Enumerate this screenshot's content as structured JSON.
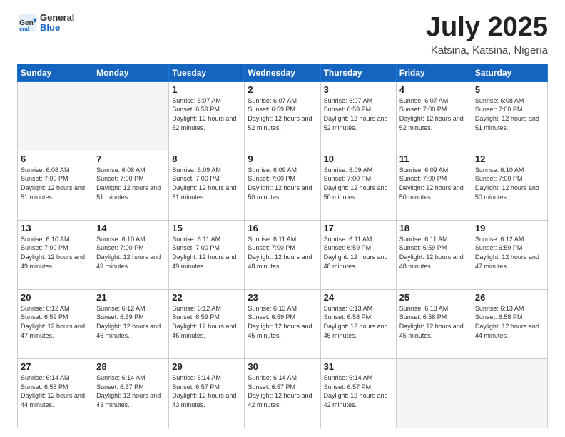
{
  "header": {
    "logo": {
      "general": "General",
      "blue": "Blue"
    },
    "title": "July 2025",
    "location": "Katsina, Katsina, Nigeria"
  },
  "weekdays": [
    "Sunday",
    "Monday",
    "Tuesday",
    "Wednesday",
    "Thursday",
    "Friday",
    "Saturday"
  ],
  "weeks": [
    [
      {
        "day": "",
        "info": ""
      },
      {
        "day": "",
        "info": ""
      },
      {
        "day": "1",
        "info": "Sunrise: 6:07 AM\nSunset: 6:59 PM\nDaylight: 12 hours and 52 minutes."
      },
      {
        "day": "2",
        "info": "Sunrise: 6:07 AM\nSunset: 6:59 PM\nDaylight: 12 hours and 52 minutes."
      },
      {
        "day": "3",
        "info": "Sunrise: 6:07 AM\nSunset: 6:59 PM\nDaylight: 12 hours and 52 minutes."
      },
      {
        "day": "4",
        "info": "Sunrise: 6:07 AM\nSunset: 7:00 PM\nDaylight: 12 hours and 52 minutes."
      },
      {
        "day": "5",
        "info": "Sunrise: 6:08 AM\nSunset: 7:00 PM\nDaylight: 12 hours and 51 minutes."
      }
    ],
    [
      {
        "day": "6",
        "info": "Sunrise: 6:08 AM\nSunset: 7:00 PM\nDaylight: 12 hours and 51 minutes."
      },
      {
        "day": "7",
        "info": "Sunrise: 6:08 AM\nSunset: 7:00 PM\nDaylight: 12 hours and 51 minutes."
      },
      {
        "day": "8",
        "info": "Sunrise: 6:09 AM\nSunset: 7:00 PM\nDaylight: 12 hours and 51 minutes."
      },
      {
        "day": "9",
        "info": "Sunrise: 6:09 AM\nSunset: 7:00 PM\nDaylight: 12 hours and 50 minutes."
      },
      {
        "day": "10",
        "info": "Sunrise: 6:09 AM\nSunset: 7:00 PM\nDaylight: 12 hours and 50 minutes."
      },
      {
        "day": "11",
        "info": "Sunrise: 6:09 AM\nSunset: 7:00 PM\nDaylight: 12 hours and 50 minutes."
      },
      {
        "day": "12",
        "info": "Sunrise: 6:10 AM\nSunset: 7:00 PM\nDaylight: 12 hours and 50 minutes."
      }
    ],
    [
      {
        "day": "13",
        "info": "Sunrise: 6:10 AM\nSunset: 7:00 PM\nDaylight: 12 hours and 49 minutes."
      },
      {
        "day": "14",
        "info": "Sunrise: 6:10 AM\nSunset: 7:00 PM\nDaylight: 12 hours and 49 minutes."
      },
      {
        "day": "15",
        "info": "Sunrise: 6:11 AM\nSunset: 7:00 PM\nDaylight: 12 hours and 49 minutes."
      },
      {
        "day": "16",
        "info": "Sunrise: 6:11 AM\nSunset: 7:00 PM\nDaylight: 12 hours and 48 minutes."
      },
      {
        "day": "17",
        "info": "Sunrise: 6:11 AM\nSunset: 6:59 PM\nDaylight: 12 hours and 48 minutes."
      },
      {
        "day": "18",
        "info": "Sunrise: 6:11 AM\nSunset: 6:59 PM\nDaylight: 12 hours and 48 minutes."
      },
      {
        "day": "19",
        "info": "Sunrise: 6:12 AM\nSunset: 6:59 PM\nDaylight: 12 hours and 47 minutes."
      }
    ],
    [
      {
        "day": "20",
        "info": "Sunrise: 6:12 AM\nSunset: 6:59 PM\nDaylight: 12 hours and 47 minutes."
      },
      {
        "day": "21",
        "info": "Sunrise: 6:12 AM\nSunset: 6:59 PM\nDaylight: 12 hours and 46 minutes."
      },
      {
        "day": "22",
        "info": "Sunrise: 6:12 AM\nSunset: 6:59 PM\nDaylight: 12 hours and 46 minutes."
      },
      {
        "day": "23",
        "info": "Sunrise: 6:13 AM\nSunset: 6:59 PM\nDaylight: 12 hours and 45 minutes."
      },
      {
        "day": "24",
        "info": "Sunrise: 6:13 AM\nSunset: 6:58 PM\nDaylight: 12 hours and 45 minutes."
      },
      {
        "day": "25",
        "info": "Sunrise: 6:13 AM\nSunset: 6:58 PM\nDaylight: 12 hours and 45 minutes."
      },
      {
        "day": "26",
        "info": "Sunrise: 6:13 AM\nSunset: 6:58 PM\nDaylight: 12 hours and 44 minutes."
      }
    ],
    [
      {
        "day": "27",
        "info": "Sunrise: 6:14 AM\nSunset: 6:58 PM\nDaylight: 12 hours and 44 minutes."
      },
      {
        "day": "28",
        "info": "Sunrise: 6:14 AM\nSunset: 6:57 PM\nDaylight: 12 hours and 43 minutes."
      },
      {
        "day": "29",
        "info": "Sunrise: 6:14 AM\nSunset: 6:57 PM\nDaylight: 12 hours and 43 minutes."
      },
      {
        "day": "30",
        "info": "Sunrise: 6:14 AM\nSunset: 6:57 PM\nDaylight: 12 hours and 42 minutes."
      },
      {
        "day": "31",
        "info": "Sunrise: 6:14 AM\nSunset: 6:57 PM\nDaylight: 12 hours and 42 minutes."
      },
      {
        "day": "",
        "info": ""
      },
      {
        "day": "",
        "info": ""
      }
    ]
  ]
}
